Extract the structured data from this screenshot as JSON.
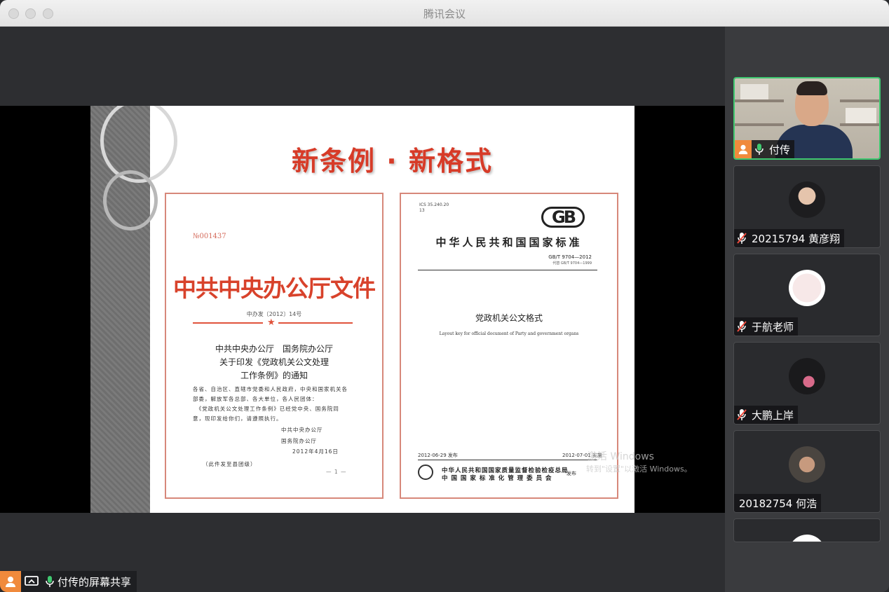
{
  "window": {
    "title": "腾讯会议"
  },
  "slide": {
    "title": "新条例 · 新格式",
    "left_doc": {
      "serial": "№001437",
      "header": "中共中央办公厅文件",
      "doc_number": "中办发〔2012〕14号",
      "notice_lines": [
        "中共中央办公厅　国务院办公厅",
        "关于印发《党政机关公文处理",
        "工作条例》的通知"
      ],
      "body_lines": [
        "各省、自治区、直辖市党委和人民政府，中央和国家机关各",
        "部委，解放军各总部、各大单位，各人民团体：",
        "　《党政机关公文处理工作条例》已经党中央、国务院同",
        "意，现印发给你们，请遵照执行。"
      ],
      "sign_org1": "中共中央办公厅",
      "sign_org2": "国务院办公厅",
      "sign_date": "2012年4月16日",
      "distribution": "（此件发至县团级）",
      "page": "— 1 —"
    },
    "right_doc": {
      "ics": "ICS 35.240.20",
      "ics2": "13",
      "logo": "GB",
      "header": "中华人民共和国国家标准",
      "code": "GB/T 9704—2012",
      "replaces": "代替 GB/T 9704—1999",
      "title_cn": "党政机关公文格式",
      "title_en": "Layout key for official document of Party and government organs",
      "issue_date": "2012-06-29 发布",
      "impl_date": "2012-07-01 实施",
      "org1": "中华人民共和国国家质量监督检验检疫总局",
      "org2": "中 国 国 家 标 准 化 管 理 委 员 会",
      "publish": "发布"
    }
  },
  "watermark": {
    "line1": "激活 Windows",
    "line2": "转到\"设置\"以激活 Windows。"
  },
  "share": {
    "label": "付传的屏幕共享"
  },
  "participants": [
    {
      "name": "付传",
      "mic": "on",
      "active": true
    },
    {
      "name": "20215794 黄彦翔",
      "mic": "muted"
    },
    {
      "name": "于航老师",
      "mic": "muted"
    },
    {
      "name": "大鹏上岸",
      "mic": "muted"
    },
    {
      "name": "20182754 何浩",
      "mic": "none"
    }
  ],
  "colors": {
    "accent_green": "#3fc870",
    "slide_red": "#d73b28",
    "avatar_orange": "#f08a3c"
  },
  "icons": [
    "user-avatar-icon",
    "mic-on-icon",
    "mic-muted-icon",
    "screen-share-icon"
  ]
}
